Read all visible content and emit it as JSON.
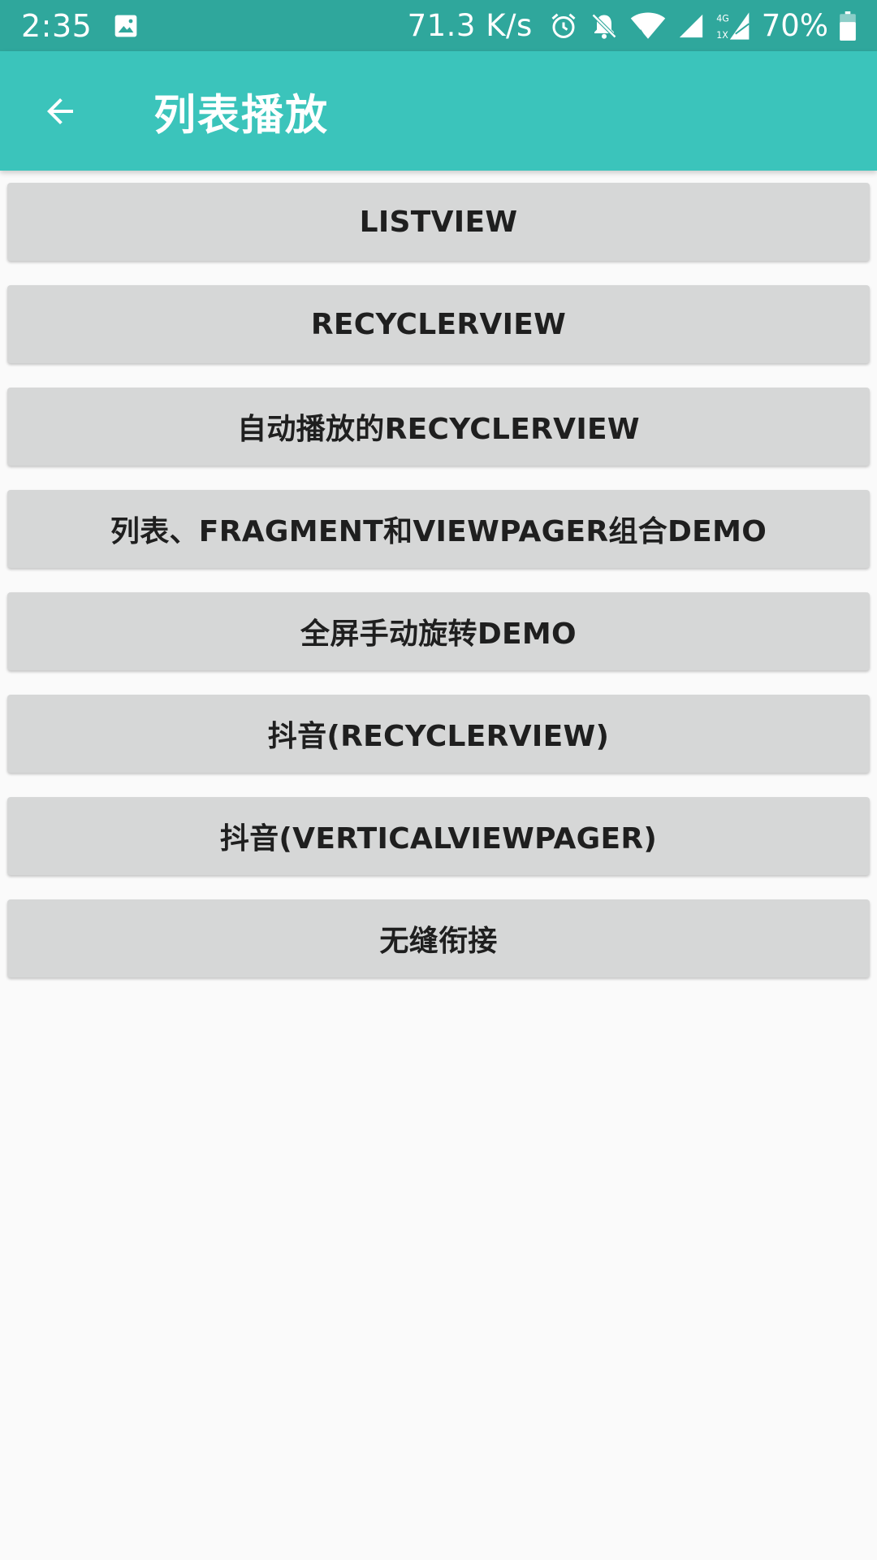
{
  "status_bar": {
    "time": "2:35",
    "net_speed": "71.3 K/s",
    "battery": "70%",
    "icons": [
      "image-icon",
      "alarm-icon",
      "notifications-off-icon",
      "wifi-icon",
      "signal-icon",
      "signal-4g-icon",
      "battery-icon"
    ],
    "background": "#2fa79c"
  },
  "app_bar": {
    "title": "列表播放",
    "back_icon": "arrow-back-icon",
    "background": "#3bc4bb"
  },
  "buttons": [
    {
      "label": "LISTVIEW"
    },
    {
      "label": "RECYCLERVIEW"
    },
    {
      "label": "自动播放的RECYCLERVIEW"
    },
    {
      "label": "列表、FRAGMENT和VIEWPAGER组合DEMO"
    },
    {
      "label": "全屏手动旋转DEMO"
    },
    {
      "label": "抖音(RECYCLERVIEW)"
    },
    {
      "label": "抖音(VERTICALVIEWPAGER)"
    },
    {
      "label": "无缝衔接"
    }
  ],
  "colors": {
    "button_bg": "#d6d7d7",
    "button_text": "#1f1f1f",
    "page_bg": "#fafafa"
  }
}
